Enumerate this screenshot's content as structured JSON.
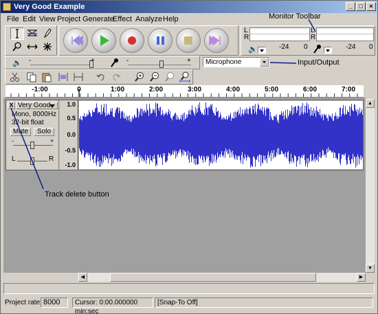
{
  "window": {
    "title": "Very Good Example",
    "controls": [
      "_",
      "□",
      "×"
    ]
  },
  "menu": [
    "File",
    "Edit",
    "View",
    "Project",
    "Generate",
    "Effect",
    "Analyze",
    "Help"
  ],
  "annotations": {
    "monitor_toolbar": "Monitor Toolbar",
    "input_output": "Input/Output",
    "track_delete": "Track delete button"
  },
  "meters": {
    "output": {
      "L": "L",
      "R": "R",
      "scale_left": "-24",
      "scale_right": "0"
    },
    "input": {
      "L": "L",
      "R": "R",
      "scale_left": "-24",
      "scale_right": "0"
    }
  },
  "mixer": {
    "minus": "-",
    "plus": "+",
    "minus2": "-",
    "plus2": "+"
  },
  "input_source": {
    "value": "Microphone"
  },
  "timeline": {
    "labels": [
      "-1:00",
      "0",
      "1:00",
      "2:00",
      "3:00",
      "4:00",
      "5:00",
      "6:00",
      "7:00"
    ]
  },
  "track": {
    "name": "Very Good",
    "close_label": "X",
    "format": "Mono, 8000Hz",
    "bits": "32-bit float",
    "mute": "Mute",
    "solo": "Solo",
    "gain_minus": "-",
    "gain_plus": "+",
    "pan_left": "L",
    "pan_right": "R",
    "scale": [
      "1.0",
      "0.5",
      "0.0",
      "-0.5",
      "-1.0"
    ]
  },
  "status": {
    "rate_label": "Project rate:",
    "rate_value": "8000",
    "cursor": "Cursor: 0:00.000000 min:sec",
    "snap": "[Snap-To Off]"
  },
  "colors": {
    "waveform": "#3232c8",
    "title_start": "#0a246a",
    "title_end": "#a6caf0",
    "annotation_line": "#0a1e8a"
  }
}
